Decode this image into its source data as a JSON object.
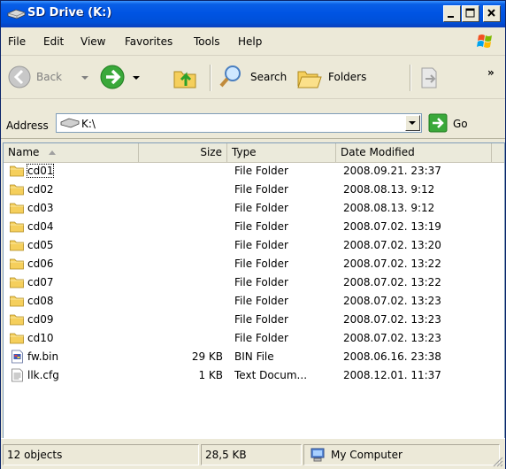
{
  "window": {
    "title": "SD Drive (K:)"
  },
  "menu": [
    "File",
    "Edit",
    "View",
    "Favorites",
    "Tools",
    "Help"
  ],
  "toolbar": {
    "back": "Back",
    "search": "Search",
    "folders": "Folders",
    "overflow": "»"
  },
  "address": {
    "label": "Address",
    "value": "K:\\",
    "go": "Go"
  },
  "columns": {
    "name": "Name",
    "size": "Size",
    "type": "Type",
    "date": "Date Modified"
  },
  "files": [
    {
      "name": "cd01",
      "size": "",
      "type": "File Folder",
      "date": "2008.09.21. 23:37",
      "icon": "folder-icon"
    },
    {
      "name": "cd02",
      "size": "",
      "type": "File Folder",
      "date": "2008.08.13. 9:12",
      "icon": "folder-icon"
    },
    {
      "name": "cd03",
      "size": "",
      "type": "File Folder",
      "date": "2008.08.13. 9:12",
      "icon": "folder-icon"
    },
    {
      "name": "cd04",
      "size": "",
      "type": "File Folder",
      "date": "2008.07.02. 13:19",
      "icon": "folder-icon"
    },
    {
      "name": "cd05",
      "size": "",
      "type": "File Folder",
      "date": "2008.07.02. 13:20",
      "icon": "folder-icon"
    },
    {
      "name": "cd06",
      "size": "",
      "type": "File Folder",
      "date": "2008.07.02. 13:22",
      "icon": "folder-icon"
    },
    {
      "name": "cd07",
      "size": "",
      "type": "File Folder",
      "date": "2008.07.02. 13:22",
      "icon": "folder-icon"
    },
    {
      "name": "cd08",
      "size": "",
      "type": "File Folder",
      "date": "2008.07.02. 13:23",
      "icon": "folder-icon"
    },
    {
      "name": "cd09",
      "size": "",
      "type": "File Folder",
      "date": "2008.07.02. 13:23",
      "icon": "folder-icon"
    },
    {
      "name": "cd10",
      "size": "",
      "type": "File Folder",
      "date": "2008.07.02. 13:23",
      "icon": "folder-icon"
    },
    {
      "name": "fw.bin",
      "size": "29 KB",
      "type": "BIN File",
      "date": "2008.06.16. 23:38",
      "icon": "bin-file-icon"
    },
    {
      "name": "llk.cfg",
      "size": "1 KB",
      "type": "Text Docum...",
      "date": "2008.12.01. 11:37",
      "icon": "text-file-icon"
    }
  ],
  "status": {
    "objects": "12 objects",
    "size": "28,5 KB",
    "zone": "My Computer"
  }
}
